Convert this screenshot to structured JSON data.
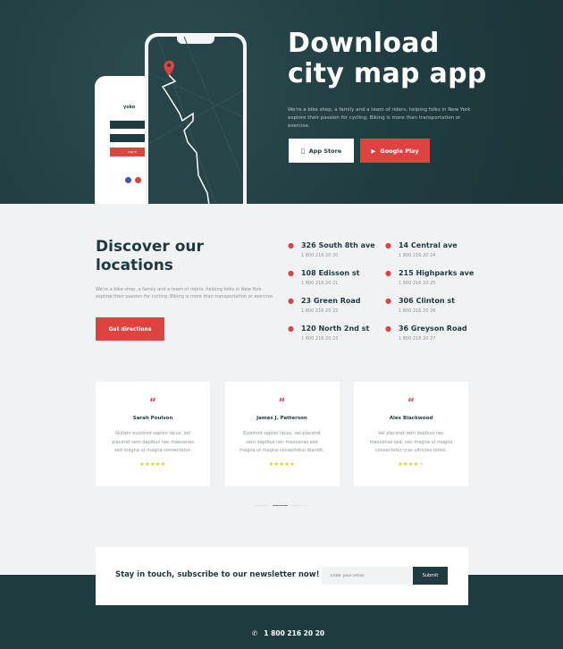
{
  "hero": {
    "title_line1": "Download",
    "title_line2": "city map app",
    "text": "We're a bike shop, a family and a team of riders, helping folks in New York explore their passion for cycling. Biking is more than transportation or exercise.",
    "app_store": "App Store",
    "google_play": "Google Play",
    "phone_brand": "yoko",
    "login_button": "Log in"
  },
  "locations": {
    "title_line1": "Discover our",
    "title_line2": "locations",
    "text": "We're a bike shop, a family and a team of riders, helping folks in New York explore their passion for cycling. Biking is more than transportation or exercise.",
    "button": "Get directions",
    "items": [
      {
        "name": "326 South 8th ave",
        "phone": "1 800 216 20 20"
      },
      {
        "name": "108 Edisson st",
        "phone": "1 800 216 20 21"
      },
      {
        "name": "23 Green Road",
        "phone": "1 800 216 20 22"
      },
      {
        "name": "120 North 2nd st",
        "phone": "1 800 216 20 23"
      },
      {
        "name": "14 Central ave",
        "phone": "1 800 216 20 24"
      },
      {
        "name": "215 Highparks ave",
        "phone": "1 800 216 20 25"
      },
      {
        "name": "306 Clinton st",
        "phone": "1 800 216 20 26"
      },
      {
        "name": "36 Greyson Road",
        "phone": "1 800 216 20 27"
      }
    ]
  },
  "testimonials": [
    {
      "name": "Sarah Poulson",
      "text": "Nullam euismod sapien lacus, vel placerat sem dapibus nec maecenas sed magna ut magna consectetur.",
      "rating": 5
    },
    {
      "name": "James J. Patterson",
      "text": "Euismod sapien lacus, vel placerat sem dapibus nec maecenas sed magna ut magna consectetur blandit.",
      "rating": 5
    },
    {
      "name": "Alex Blackwood",
      "text": "Vel placerat sem dapibus nec maecenas sed, nec magna ut magna consectetur cras ultricies tortor.",
      "rating": 4
    }
  ],
  "carousel": {
    "active_index": 1,
    "count": 3
  },
  "newsletter": {
    "title": "Stay in touch, subscribe to our newsletter now!",
    "placeholder": "Enter your email",
    "submit": "Submit"
  },
  "footer": {
    "phone": "1 800 216 20 20"
  },
  "colors": {
    "accent": "#e0423f",
    "dark": "#1e3b40",
    "star": "#f2c100"
  }
}
